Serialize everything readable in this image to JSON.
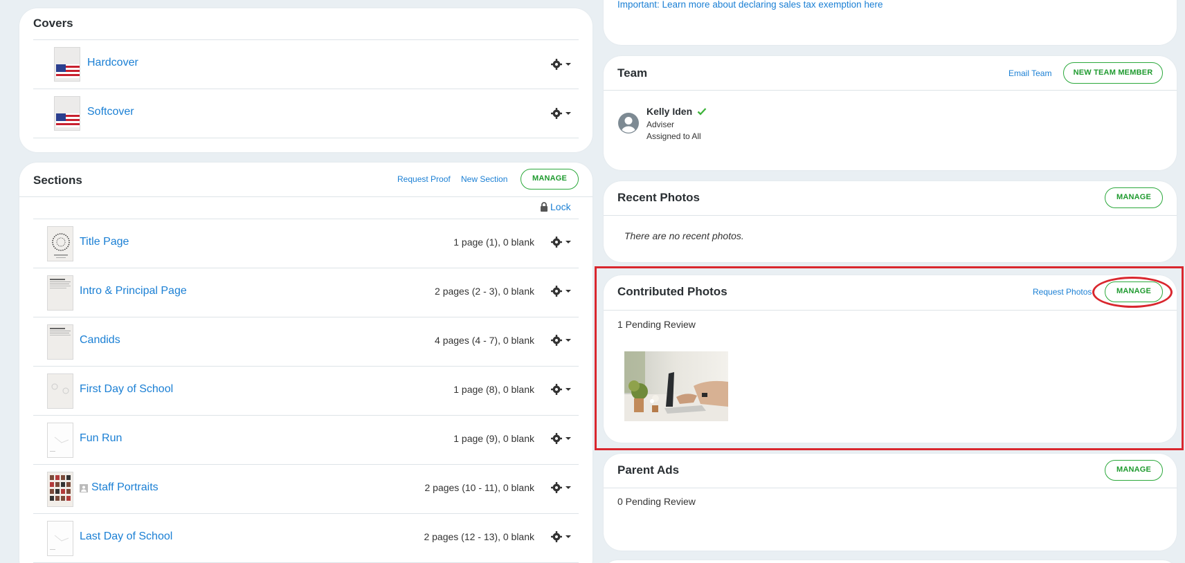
{
  "colors": {
    "link": "#1a7fd4",
    "green": "#2aa83a",
    "highlight": "#d9272e",
    "bg": "#e9eff3"
  },
  "tax": {
    "link": "Important: Learn more about declaring sales tax exemption here"
  },
  "covers": {
    "title": "Covers",
    "items": [
      {
        "label": "Hardcover",
        "icon": "gear-icon"
      },
      {
        "label": "Softcover",
        "icon": "gear-icon"
      }
    ]
  },
  "sections": {
    "title": "Sections",
    "request_proof": "Request Proof",
    "new_section": "New Section",
    "manage": "MANAGE",
    "lock": "Lock",
    "items": [
      {
        "label": "Title Page",
        "meta": "1 page (1), 0 blank"
      },
      {
        "label": "Intro & Principal Page",
        "meta": "2 pages (2 - 3), 0 blank"
      },
      {
        "label": "Candids",
        "meta": "4 pages (4 - 7), 0 blank"
      },
      {
        "label": "First Day of School",
        "meta": "1 page (8), 0 blank"
      },
      {
        "label": "Fun Run",
        "meta": "1 page (9), 0 blank"
      },
      {
        "label": "Staff Portraits",
        "meta": "2 pages (10 - 11), 0 blank"
      },
      {
        "label": "Last Day of School",
        "meta": "2 pages (12 - 13), 0 blank"
      }
    ]
  },
  "team": {
    "title": "Team",
    "email_team": "Email Team",
    "new_member": "NEW TEAM MEMBER",
    "member": {
      "name": "Kelly Iden",
      "role": "Adviser",
      "assignment": "Assigned to All"
    }
  },
  "recent_photos": {
    "title": "Recent Photos",
    "manage": "MANAGE",
    "empty": "There are no recent photos."
  },
  "contributed_photos": {
    "title": "Contributed Photos",
    "request": "Request Photos",
    "manage": "MANAGE",
    "pending": "1 Pending Review"
  },
  "parent_ads": {
    "title": "Parent Ads",
    "manage": "MANAGE",
    "pending": "0 Pending Review"
  }
}
